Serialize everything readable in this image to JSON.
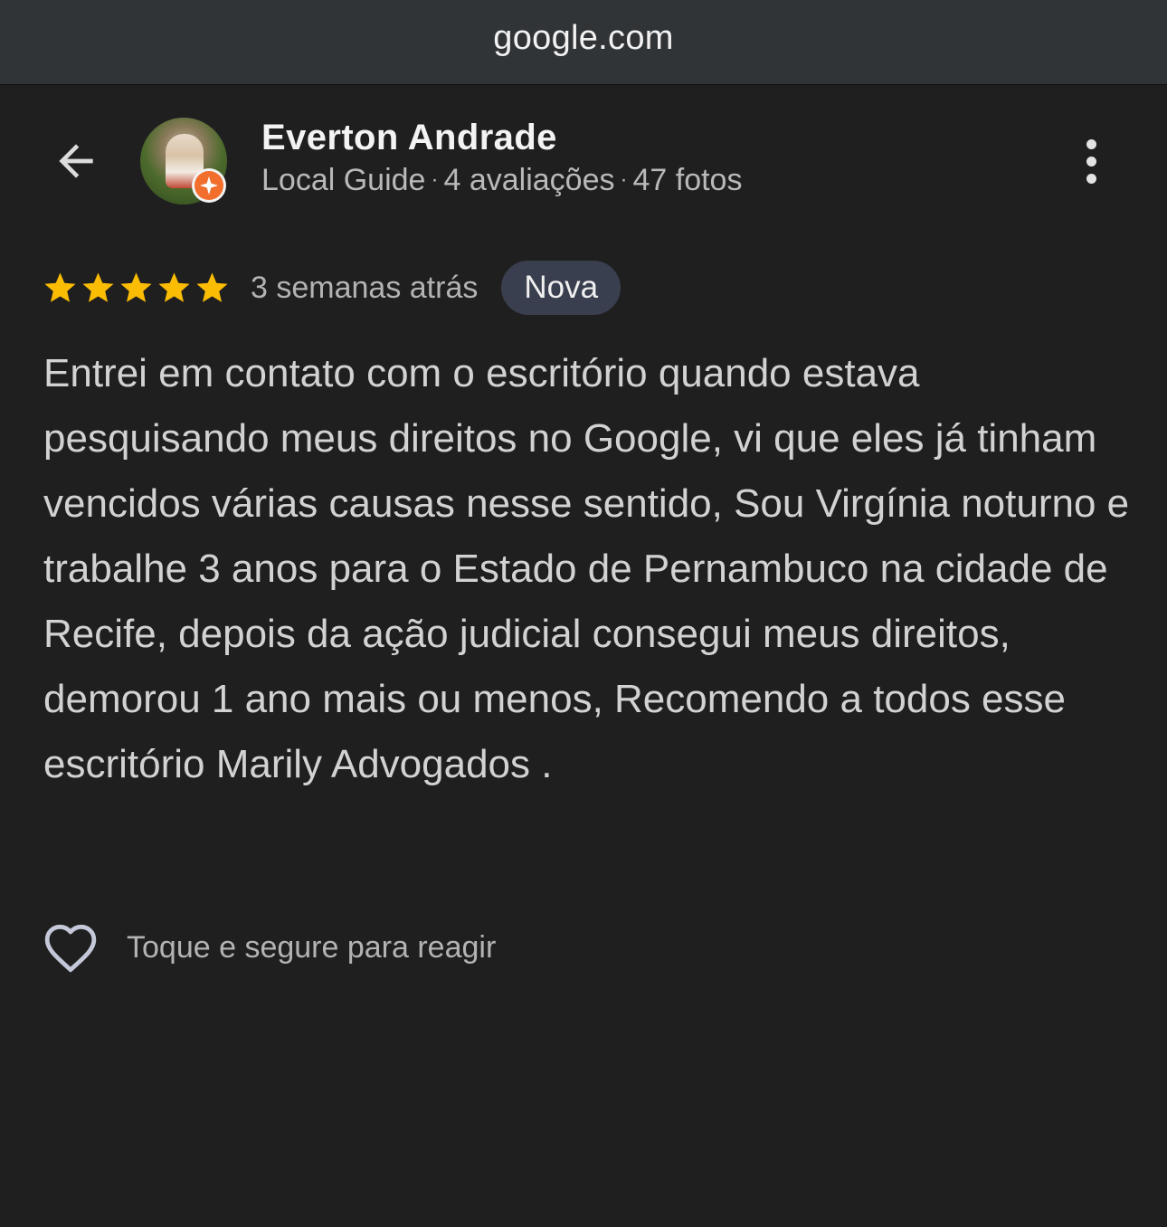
{
  "browser": {
    "url": "google.com"
  },
  "header": {
    "back_icon": "arrow-left-icon",
    "more_icon": "more-vert-icon"
  },
  "reviewer": {
    "name": "Everton Andrade",
    "badge": "Local Guide",
    "reviews": "4 avaliações",
    "photos": "47 fotos",
    "separator": "·",
    "badge_color": "#f16e2c"
  },
  "review": {
    "rating": 5,
    "rating_max": 5,
    "star_color": "#fbbc04",
    "time_ago": "3 semanas atrás",
    "new_label": "Nova",
    "text": "Entrei em contato com o escritório quando estava pesquisando meus direitos no Google, vi que eles já tinham vencidos várias causas nesse sentido, Sou Virgínia noturno e trabalhe 3 anos para o Estado de Pernambuco na cidade de Recife, depois da ação judicial consegui meus direitos, demorou 1 ano mais ou menos, Recomendo a todos esse escritório Marily Advogados ."
  },
  "reaction": {
    "icon": "heart-outline-icon",
    "label": "Toque e segure para reagir"
  }
}
